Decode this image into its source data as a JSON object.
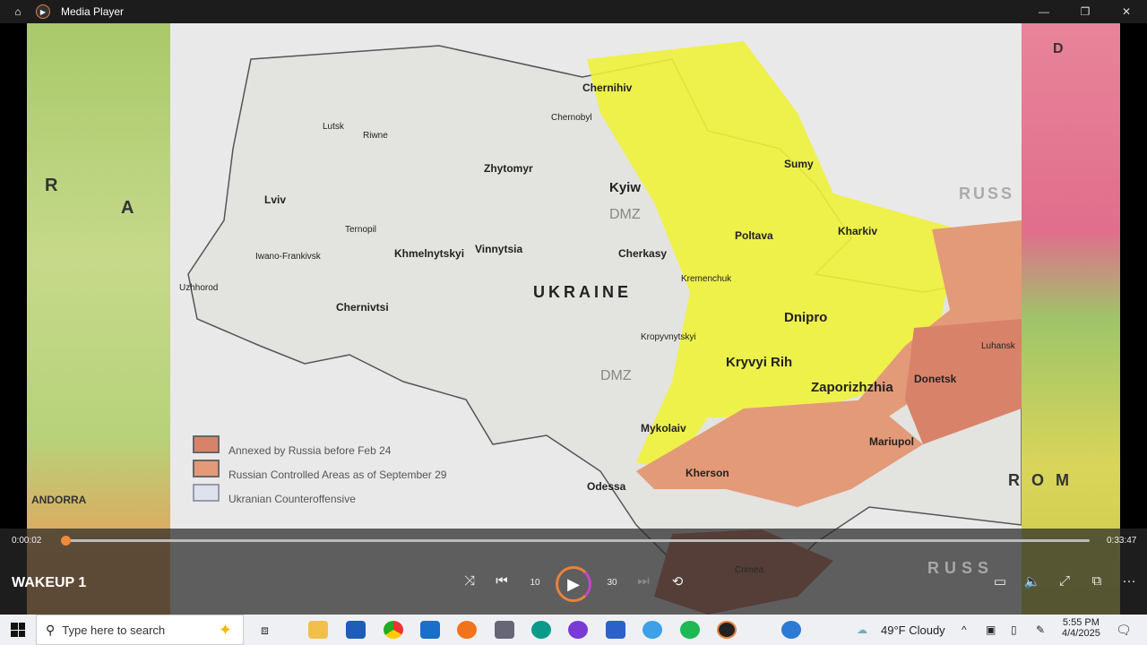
{
  "window": {
    "title": "Media Player",
    "home_icon": "home-icon",
    "app_icon": "media-player-icon"
  },
  "map": {
    "country_label": "UKRAINE",
    "cities": [
      "Chernihiv",
      "Chernobyl",
      "Lutsk",
      "Riwne",
      "Zhytomyr",
      "Kyiw",
      "Lviv",
      "Sumy",
      "Ternopil",
      "Khmelnytskyi",
      "Vinnytsia",
      "Cherkasy",
      "Poltava",
      "Kharkiv",
      "Iwano-Frankivsk",
      "Uzhhorod",
      "Kremenchuk",
      "Chernivtsi",
      "Dnipro",
      "Kropyvnytskyi",
      "Luhansk",
      "Kryvyi Rih",
      "Zaporizhzhia",
      "Donetsk",
      "Mykolaiv",
      "Mariupol",
      "Kherson",
      "Odessa",
      "Crimea"
    ],
    "side_labels": [
      "RUSS",
      "RUSS",
      "R",
      "A",
      "R O M",
      "ANDORRA",
      "D"
    ],
    "annotations": [
      "DMZ",
      "DMZ"
    ],
    "legend": [
      "Annexed by Russia before Feb 24",
      "Russian Controlled Areas as of September 29",
      "Ukranian Counteroffensive"
    ],
    "colors": {
      "annexed": "#d9826a",
      "controlled": "#e39a78",
      "counteroffensive": "#eef23a"
    }
  },
  "player": {
    "current_time": "0:00:02",
    "total_time": "0:33:47",
    "progress": 0.001,
    "video_title": "WAKEUP 1",
    "accent": "#f08a3c",
    "buttons": [
      "shuffle",
      "previous",
      "rewind-10",
      "play",
      "forward-30",
      "next",
      "repeat-off",
      "captions",
      "volume",
      "fullscreen",
      "mini-player",
      "more"
    ],
    "rewind_label": "10",
    "forward_label": "30",
    "more_label": "···"
  },
  "taskbar": {
    "search_placeholder": "Type here to search",
    "weather": "49°F  Cloudy",
    "time": "5:55 PM",
    "date": "4/4/2025"
  }
}
